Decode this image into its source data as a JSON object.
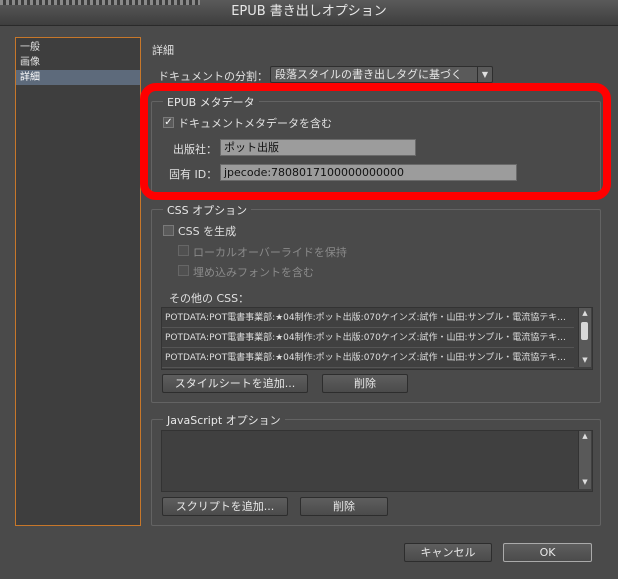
{
  "window": {
    "title": "EPUB 書き出しオプション"
  },
  "sidebar": {
    "items": [
      {
        "label": "一般"
      },
      {
        "label": "画像"
      },
      {
        "label": "詳細"
      }
    ],
    "selected": "詳細"
  },
  "section_title": "詳細",
  "split": {
    "label": "ドキュメントの分割：",
    "value": "段落スタイルの書き出しタグに基づく"
  },
  "metadata": {
    "title": "EPUB メタデータ",
    "include_label": "ドキュメントメタデータを含む",
    "include_checked": true,
    "publisher_label": "出版社：",
    "publisher_value": "ポット出版",
    "id_label": "固有 ID：",
    "id_value": "jpecode:7808017100000000000"
  },
  "css": {
    "title": "CSS オプション",
    "generate_label": "CSS を生成",
    "local_override_label": "ローカルオーバーライドを保持",
    "embed_fonts_label": "埋め込みフォントを含む",
    "other_label": "その他の CSS：",
    "rows": [
      "POTDATA:POT電書事業部:★04制作:ポット出版:070ケインズ:試作・山田:サンプル・電流協テキ...",
      "POTDATA:POT電書事業部:★04制作:ポット出版:070ケインズ:試作・山田:サンプル・電流協テキ...",
      "POTDATA:POT電書事業部:★04制作:ポット出版:070ケインズ:試作・山田:サンプル・電流協テキ..."
    ],
    "add_button": "スタイルシートを追加...",
    "delete_button": "削除"
  },
  "javascript": {
    "title": "JavaScript オプション",
    "add_button": "スクリプトを追加...",
    "delete_button": "削除"
  },
  "footer": {
    "cancel": "キャンセル",
    "ok": "OK"
  },
  "colors": {
    "highlight": "#ff0000",
    "sidebar_border": "#c7772a",
    "selection": "#5d6a7b"
  }
}
